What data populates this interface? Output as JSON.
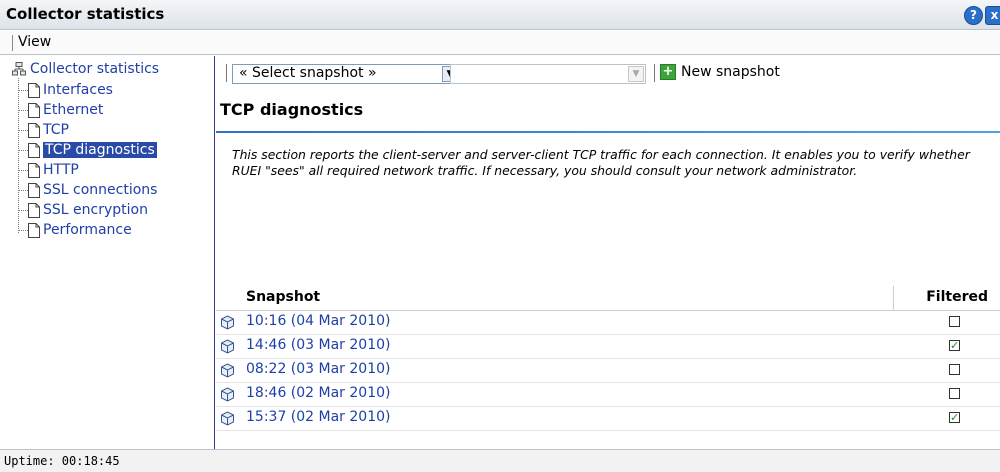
{
  "window": {
    "title": "Collector statistics",
    "help_glyph": "?",
    "close_glyph": "x"
  },
  "menu": {
    "view": "View"
  },
  "sidebar": {
    "root": "Collector statistics",
    "items": [
      {
        "label": "Interfaces"
      },
      {
        "label": "Ethernet"
      },
      {
        "label": "TCP"
      },
      {
        "label": "TCP diagnostics",
        "selected": true
      },
      {
        "label": "HTTP"
      },
      {
        "label": "SSL connections"
      },
      {
        "label": "SSL encryption"
      },
      {
        "label": "Performance"
      }
    ]
  },
  "toolbar": {
    "snapshot_select": "« Select snapshot »",
    "second_select": "",
    "new_snapshot": "New snapshot",
    "dropdown_glyph": "▼",
    "plus_glyph": "+"
  },
  "main": {
    "title": "TCP diagnostics",
    "description": "This section reports the client-server and server-client TCP traffic for each connection. It enables you to verify whether RUEI \"sees\" all required network traffic. If necessary, you should consult your network administrator."
  },
  "table": {
    "columns": {
      "snapshot": "Snapshot",
      "filtered": "Filtered"
    },
    "rows": [
      {
        "snapshot": "10:16 (04 Mar 2010)",
        "filtered": false
      },
      {
        "snapshot": "14:46 (03 Mar 2010)",
        "filtered": true
      },
      {
        "snapshot": "08:22 (03 Mar 2010)",
        "filtered": false
      },
      {
        "snapshot": "18:46 (02 Mar 2010)",
        "filtered": false
      },
      {
        "snapshot": "15:37 (02 Mar 2010)",
        "filtered": true
      }
    ],
    "check_glyph": "✓"
  },
  "status": {
    "text": "Uptime: 00:18:45"
  },
  "colors": {
    "accent": "#2a4aa7",
    "link": "#1f3fa8",
    "rule": "#2f6fc9"
  }
}
